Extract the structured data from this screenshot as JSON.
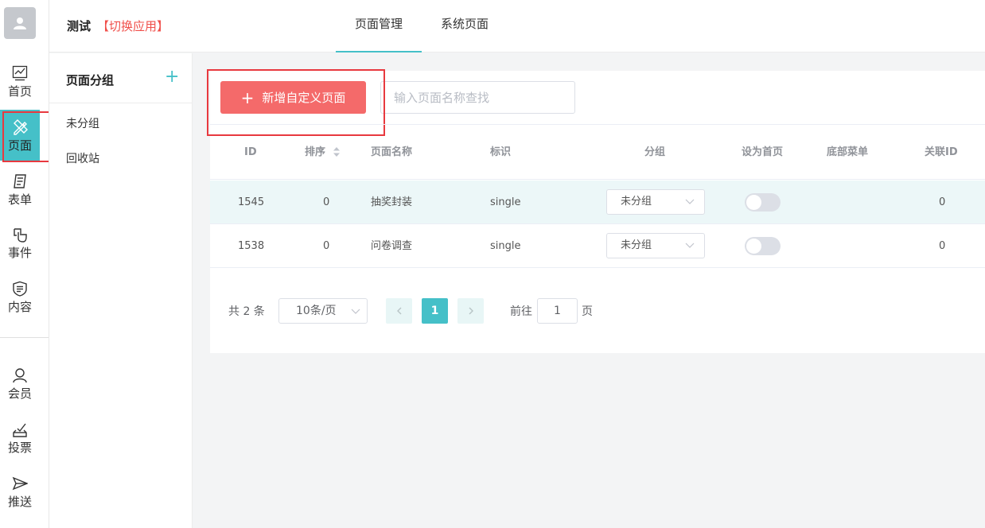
{
  "sidebar": {
    "items": [
      {
        "label": "首页",
        "icon": "line-chart-icon"
      },
      {
        "label": "页面",
        "icon": "pencil-ruler-icon"
      },
      {
        "label": "表单",
        "icon": "form-doc-icon"
      },
      {
        "label": "事件",
        "icon": "hand-touch-icon"
      },
      {
        "label": "内容",
        "icon": "content-shield-icon"
      },
      {
        "label": "会员",
        "icon": "user-icon"
      },
      {
        "label": "投票",
        "icon": "ballot-box-icon"
      },
      {
        "label": "推送",
        "icon": "send-icon"
      }
    ],
    "active_index": 1
  },
  "header": {
    "app_name": "测试",
    "switch_app": "【切换应用】",
    "tabs": [
      {
        "label": "页面管理",
        "active": true
      },
      {
        "label": "系统页面",
        "active": false
      }
    ]
  },
  "groups": {
    "title": "页面分组",
    "add_symbol": "+",
    "items": [
      "未分组",
      "回收站"
    ]
  },
  "toolbar": {
    "add_label": "新增自定义页面",
    "search_placeholder": "输入页面名称查找"
  },
  "table": {
    "columns": [
      "ID",
      "排序",
      "页面名称",
      "标识",
      "分组",
      "设为首页",
      "底部菜单",
      "关联ID"
    ],
    "rows": [
      {
        "id": "1545",
        "sort": "0",
        "name": "抽奖封装",
        "tag": "single",
        "group": "未分组",
        "homepage": false,
        "bottom_menu": "",
        "related_id": "0",
        "highlighted": true
      },
      {
        "id": "1538",
        "sort": "0",
        "name": "问卷调查",
        "tag": "single",
        "group": "未分组",
        "homepage": false,
        "bottom_menu": "",
        "related_id": "0",
        "highlighted": false
      }
    ]
  },
  "pagination": {
    "total_text": "共 2 条",
    "page_size": "10条/页",
    "current_page": "1",
    "goto_label": "前往",
    "goto_value": "1",
    "page_unit": "页"
  },
  "colors": {
    "accent": "#45c0c8",
    "primary_button": "#f46a6a",
    "switch_app_text": "#f0504b",
    "annotation_box": "#e8393f",
    "row_highlight": "#ecf7f8"
  }
}
